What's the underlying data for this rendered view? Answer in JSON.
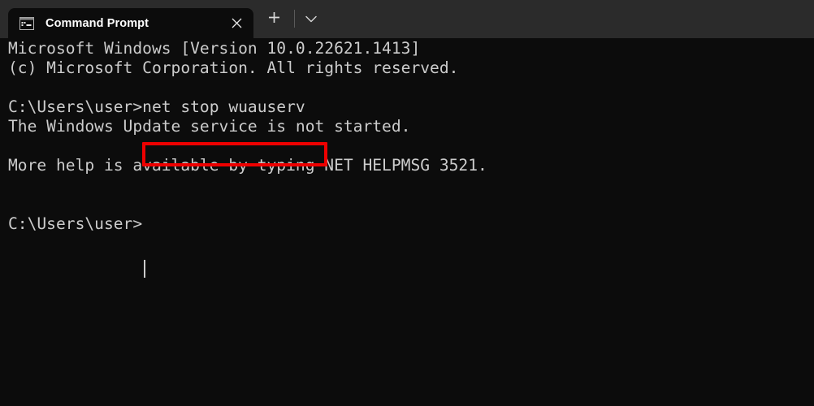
{
  "window": {
    "app_title": "Command Prompt",
    "background_color": "#0c0c0c",
    "titlebar_color": "#2b2b2b"
  },
  "titlebar": {
    "tab": {
      "label": "Command Prompt",
      "icon": "console-window-icon",
      "close_label": "×"
    },
    "new_tab_label": "+",
    "dropdown_label": "⌄"
  },
  "terminal": {
    "text_color": "#cccccc",
    "lines": [
      "Microsoft Windows [Version 10.0.22621.1413]",
      "(c) Microsoft Corporation. All rights reserved.",
      "",
      "C:\\Users\\user>net stop wuauserv",
      "The Windows Update service is not started.",
      "",
      "More help is available by typing NET HELPMSG 3521.",
      "",
      "",
      "C:\\Users\\user>"
    ],
    "full_text": "Microsoft Windows [Version 10.0.22621.1413]\n(c) Microsoft Corporation. All rights reserved.\n\nC:\\Users\\user>net stop wuauserv\nThe Windows Update service is not started.\n\nMore help is available by typing NET HELPMSG 3521.\n\n\nC:\\Users\\user>",
    "prompt": "C:\\Users\\user>",
    "typed_command": "net stop wuauserv",
    "caret_visible": true
  },
  "annotation": {
    "highlight_color": "#ee0000",
    "highlight_target": "net stop wuauserv"
  }
}
